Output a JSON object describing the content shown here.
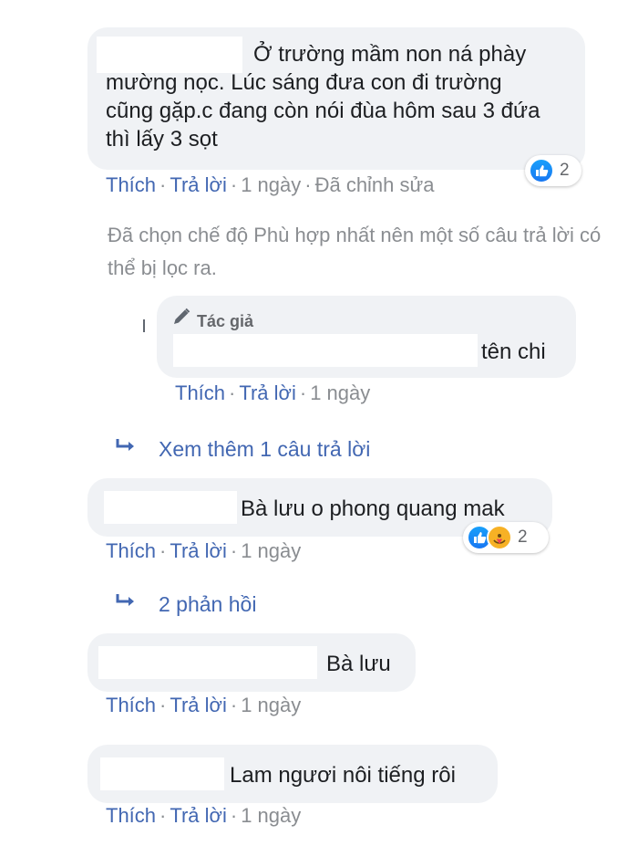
{
  "comments": [
    {
      "text_line1": "Ở trường mầm non ná phày",
      "text_rest": "mường nọc. Lúc sáng đưa con đi trường cũng gặp.c đang còn nói đùa hôm sau 3 đứa thì lấy 3 sọt",
      "like": "Thích",
      "reply": "Trả lời",
      "time": "1 ngày",
      "edited": "Đã chỉnh sửa",
      "reaction_count": "2"
    },
    {
      "author_badge": "Tác giả",
      "text": "tên chi",
      "like": "Thích",
      "reply": "Trả lời",
      "time": "1 ngày"
    },
    {
      "text": "Bà lưu o phong quang mak",
      "like": "Thích",
      "reply": "Trả lời",
      "time": "1 ngày",
      "reaction_count": "2"
    },
    {
      "text": "Bà lưu",
      "like": "Thích",
      "reply": "Trả lời",
      "time": "1 ngày"
    },
    {
      "text": "Lam ngươi nôi tiếng rôi",
      "like": "Thích",
      "reply": "Trả lời",
      "time": "1 ngày"
    }
  ],
  "filter_notice": "Đã chọn chế độ Phù hợp nhất nên một số câu trả lời có thể bị lọc ra.",
  "view_more_replies": "Xem thêm 1 câu trả lời",
  "replies_count_link": "2 phản hồi",
  "icons": {
    "pencil": "pencil-icon",
    "reply_arrow": "reply-arrow-icon",
    "like_reaction": "like-reaction-icon",
    "care_reaction": "care-reaction-icon"
  },
  "colors": {
    "link": "#4267b2",
    "bubble": "#f0f2f5",
    "meta_gray": "#8a8d91",
    "like_blue": "#1877f2"
  }
}
